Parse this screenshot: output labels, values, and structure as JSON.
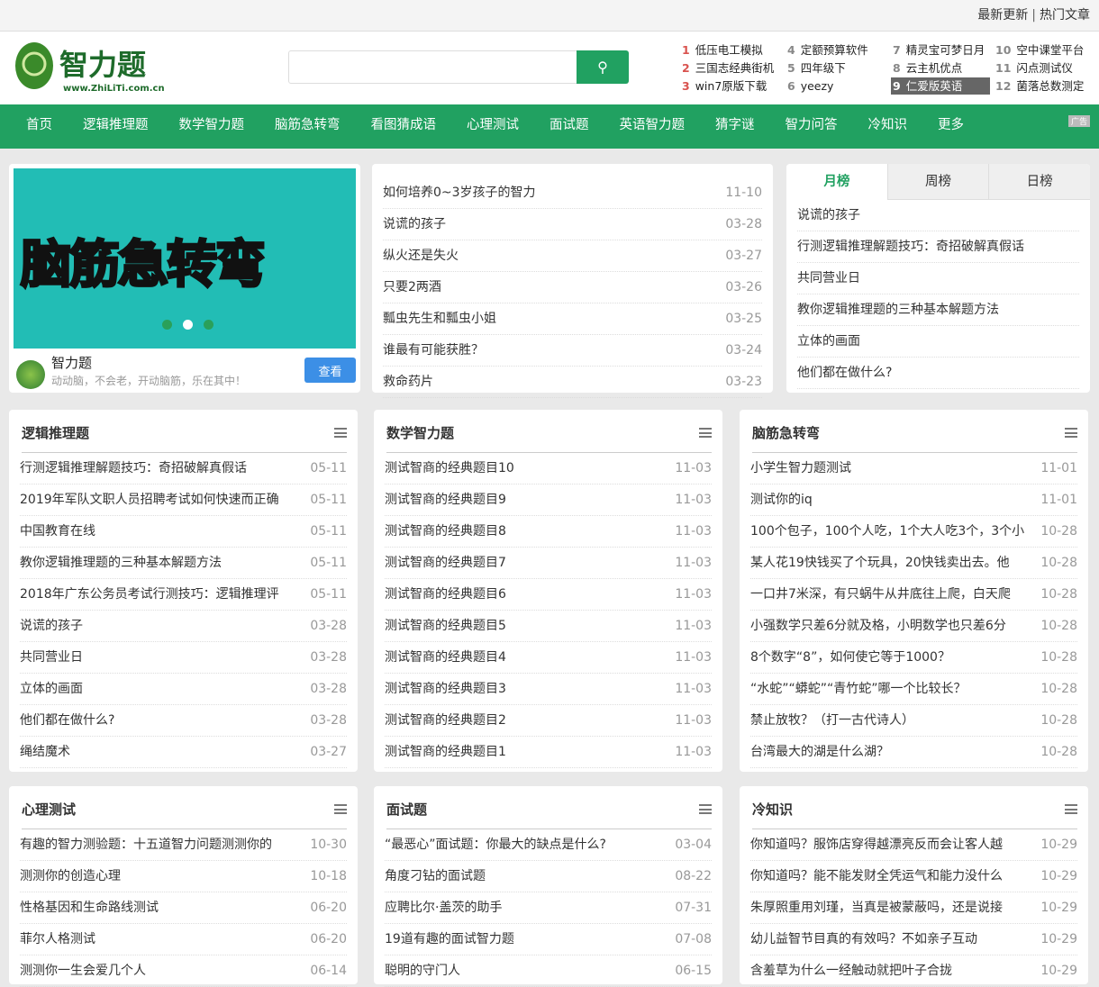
{
  "topbar": {
    "latest": "最新更新",
    "sep": "|",
    "hot": "热门文章"
  },
  "logo": {
    "name": "智力题",
    "url": "www.ZhiLiTi.com.cn"
  },
  "search": {
    "placeholder": "",
    "icon": "search-icon"
  },
  "hot_searches": [
    {
      "n": "1",
      "t": "低压电工模拟"
    },
    {
      "n": "2",
      "t": "三国志经典街机"
    },
    {
      "n": "3",
      "t": "win7原版下载"
    },
    {
      "n": "4",
      "t": "定额预算软件"
    },
    {
      "n": "5",
      "t": "四年级下"
    },
    {
      "n": "6",
      "t": "yeezy"
    },
    {
      "n": "7",
      "t": "精灵宝可梦日月"
    },
    {
      "n": "8",
      "t": "云主机优点"
    },
    {
      "n": "9",
      "t": "仁爱版英语"
    },
    {
      "n": "10",
      "t": "空中课堂平台"
    },
    {
      "n": "11",
      "t": "闪点测试仪"
    },
    {
      "n": "12",
      "t": "菌落总数测定"
    }
  ],
  "ad_label": "广告",
  "nav": [
    "首页",
    "逻辑推理题",
    "数学智力题",
    "脑筋急转弯",
    "看图猜成语",
    "心理测试",
    "面试题",
    "英语智力题",
    "猜字谜",
    "智力问答",
    "冷知识",
    "更多"
  ],
  "slider": {
    "banner_text": "脑筋急转弯",
    "active_dot": 2,
    "dot_count": 3,
    "brand": "智力题",
    "slogan": "动动脑，不会老，开动脑筋，乐在其中！",
    "button": "查看"
  },
  "latest": [
    {
      "t": "如何培养0~3岁孩子的智力",
      "d": "11-10"
    },
    {
      "t": "说谎的孩子",
      "d": "03-28"
    },
    {
      "t": "纵火还是失火",
      "d": "03-27"
    },
    {
      "t": "只要2两酒",
      "d": "03-26"
    },
    {
      "t": "瓢虫先生和瓢虫小姐",
      "d": "03-25"
    },
    {
      "t": "谁最有可能获胜？",
      "d": "03-24"
    },
    {
      "t": "救命药片",
      "d": "03-23"
    }
  ],
  "rank": {
    "tabs": [
      "月榜",
      "周榜",
      "日榜"
    ],
    "active": 0,
    "items": [
      "说谎的孩子",
      "行测逻辑推理解题技巧：奇招破解真假话",
      "共同营业日",
      "教你逻辑推理题的三种基本解题方法",
      "立体的画面",
      "他们都在做什么?"
    ]
  },
  "sections": [
    {
      "title": "逻辑推理题",
      "items": [
        {
          "t": "行测逻辑推理解题技巧：奇招破解真假话",
          "d": "05-11"
        },
        {
          "t": "2019年军队文职人员招聘考试如何快速而正确",
          "d": "05-11"
        },
        {
          "t": "中国教育在线",
          "d": "05-11"
        },
        {
          "t": "教你逻辑推理题的三种基本解题方法",
          "d": "05-11"
        },
        {
          "t": "2018年广东公务员考试行测技巧：逻辑推理评",
          "d": "05-11"
        },
        {
          "t": "说谎的孩子",
          "d": "03-28"
        },
        {
          "t": "共同营业日",
          "d": "03-28"
        },
        {
          "t": "立体的画面",
          "d": "03-28"
        },
        {
          "t": "他们都在做什么?",
          "d": "03-28"
        },
        {
          "t": "绳结魔术",
          "d": "03-27"
        }
      ]
    },
    {
      "title": "数学智力题",
      "items": [
        {
          "t": "测试智商的经典题目10",
          "d": "11-03"
        },
        {
          "t": "测试智商的经典题目9",
          "d": "11-03"
        },
        {
          "t": "测试智商的经典题目8",
          "d": "11-03"
        },
        {
          "t": "测试智商的经典题目7",
          "d": "11-03"
        },
        {
          "t": "测试智商的经典题目6",
          "d": "11-03"
        },
        {
          "t": "测试智商的经典题目5",
          "d": "11-03"
        },
        {
          "t": "测试智商的经典题目4",
          "d": "11-03"
        },
        {
          "t": "测试智商的经典题目3",
          "d": "11-03"
        },
        {
          "t": "测试智商的经典题目2",
          "d": "11-03"
        },
        {
          "t": "测试智商的经典题目1",
          "d": "11-03"
        }
      ]
    },
    {
      "title": "脑筋急转弯",
      "items": [
        {
          "t": "小学生智力题测试",
          "d": "11-01"
        },
        {
          "t": "测试你的iq",
          "d": "11-01"
        },
        {
          "t": "100个包子，100个人吃，1个大人吃3个，3个小",
          "d": "10-28"
        },
        {
          "t": "某人花19快钱买了个玩具，20快钱卖出去。他",
          "d": "10-28"
        },
        {
          "t": "一口井7米深，有只蜗牛从井底往上爬，白天爬",
          "d": "10-28"
        },
        {
          "t": "小强数学只差6分就及格，小明数学也只差6分",
          "d": "10-28"
        },
        {
          "t": " 8个数字“8”，如何使它等于1000？",
          "d": "10-28"
        },
        {
          "t": "“水蛇”“蟒蛇”“青竹蛇”哪一个比较长？",
          "d": "10-28"
        },
        {
          "t": "禁止放牧？（打一古代诗人）",
          "d": "10-28"
        },
        {
          "t": "台湾最大的湖是什么湖？",
          "d": "10-28"
        }
      ]
    },
    {
      "title": "心理测试",
      "items": [
        {
          "t": "有趣的智力测验题：十五道智力问题测测你的",
          "d": "10-30"
        },
        {
          "t": "测测你的创造心理",
          "d": "10-18"
        },
        {
          "t": "性格基因和生命路线测试",
          "d": "06-20"
        },
        {
          "t": "菲尔人格测试",
          "d": "06-20"
        },
        {
          "t": "测测你一生会爱几个人",
          "d": "06-14"
        }
      ]
    },
    {
      "title": "面试题",
      "items": [
        {
          "t": "“最恶心”面试题：你最大的缺点是什么?",
          "d": "03-04"
        },
        {
          "t": "角度刁钻的面试题",
          "d": "08-22"
        },
        {
          "t": "应聘比尔·盖茨的助手",
          "d": "07-31"
        },
        {
          "t": "19道有趣的面试智力题",
          "d": "07-08"
        },
        {
          "t": "聪明的守门人",
          "d": "06-15"
        }
      ]
    },
    {
      "title": "冷知识",
      "items": [
        {
          "t": "你知道吗？服饰店穿得越漂亮反而会让客人越",
          "d": "10-29"
        },
        {
          "t": "你知道吗？能不能发财全凭运气和能力没什么",
          "d": "10-29"
        },
        {
          "t": "朱厚照重用刘瑾，当真是被蒙蔽吗，还是说接",
          "d": "10-29"
        },
        {
          "t": "幼儿益智节目真的有效吗？不如亲子互动",
          "d": "10-29"
        },
        {
          "t": "含羞草为什么一经触动就把叶子合拢",
          "d": "10-29"
        }
      ]
    }
  ]
}
